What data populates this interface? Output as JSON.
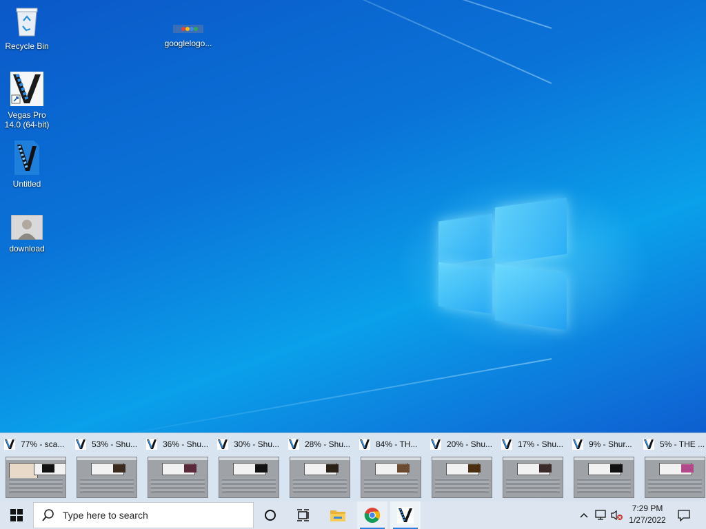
{
  "desktop": {
    "icons": [
      {
        "label": "Recycle Bin",
        "icon": "recycle-bin-icon"
      },
      {
        "label": "googlelogo...",
        "icon": "image-file-icon"
      },
      {
        "label": "Vegas Pro 14.0 (64-bit)",
        "icon": "vegas-pro-icon"
      },
      {
        "label": "Untitled",
        "icon": "vegas-project-icon"
      },
      {
        "label": "download",
        "icon": "photo-file-icon"
      }
    ]
  },
  "thumbnails": [
    {
      "title": "77% - sca..."
    },
    {
      "title": "53% - Shu..."
    },
    {
      "title": "36% - Shu..."
    },
    {
      "title": "30% - Shu..."
    },
    {
      "title": "28% - Shu..."
    },
    {
      "title": "84% - TH..."
    },
    {
      "title": "20% - Shu..."
    },
    {
      "title": "17% - Shu..."
    },
    {
      "title": "9% - Shur..."
    },
    {
      "title": "5% - THE ..."
    }
  ],
  "taskbar": {
    "search_placeholder": "Type here to search",
    "pinned": [
      "cortana-icon",
      "task-view-icon",
      "file-explorer-icon",
      "chrome-icon",
      "vegas-pro-icon"
    ],
    "tray_icons": [
      "chevron-up-icon",
      "network-icon",
      "volume-muted-icon",
      "notification-icon"
    ],
    "time": "7:29 PM",
    "date": "1/27/2022"
  },
  "colors": {
    "accent": "#2b7de0",
    "vegas_blue": "#1a6fd0"
  }
}
